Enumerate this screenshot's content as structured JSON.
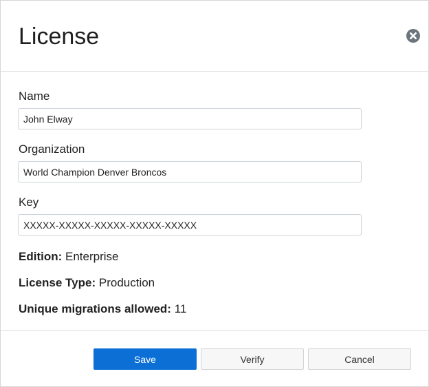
{
  "dialog": {
    "title": "License",
    "close_icon": "close-circle-icon"
  },
  "form": {
    "name_label": "Name",
    "name_value": "John Elway",
    "organization_label": "Organization",
    "organization_value": "World Champion Denver Broncos",
    "key_label": "Key",
    "key_value": "XXXXX-XXXXX-XXXXX-XXXXX-XXXXX"
  },
  "details": {
    "edition_label": "Edition:",
    "edition_value": "Enterprise",
    "license_type_label": "License Type:",
    "license_type_value": "Production",
    "migrations_label": "Unique migrations allowed:",
    "migrations_value": "11"
  },
  "footer": {
    "save_label": "Save",
    "verify_label": "Verify",
    "cancel_label": "Cancel"
  },
  "colors": {
    "primary": "#0b6fd6",
    "close_icon": "#6c757d"
  }
}
